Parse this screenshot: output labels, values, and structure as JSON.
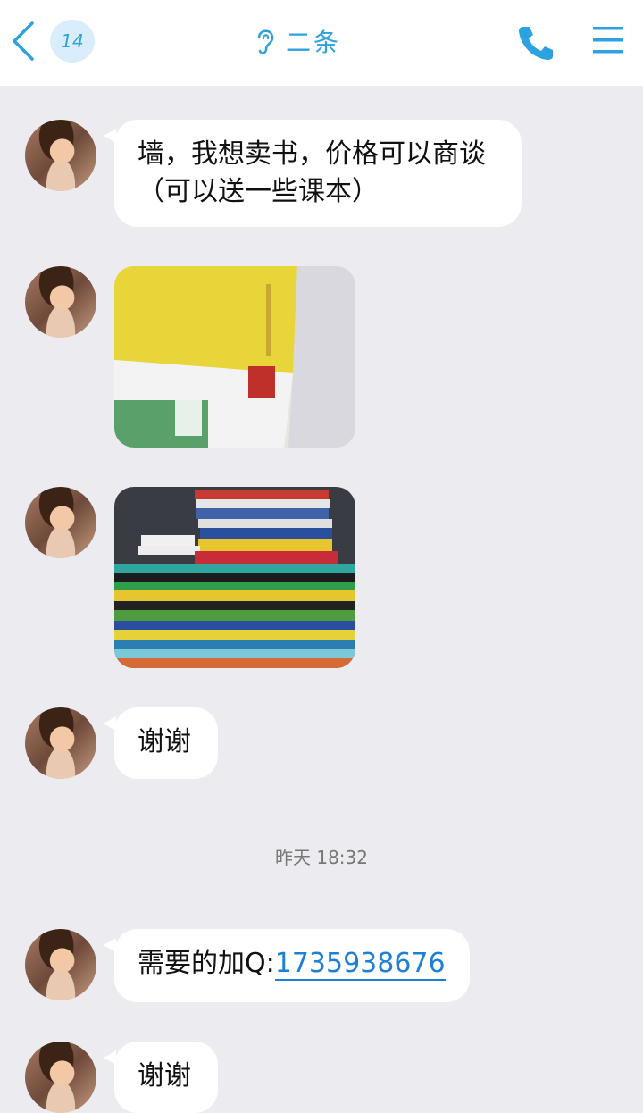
{
  "header": {
    "badge_count": "14",
    "title": "二条"
  },
  "messages": [
    {
      "text": "墙，我想卖书，价格可以商谈（可以送一些课本）"
    },
    {
      "image": "books-photo-1"
    },
    {
      "image": "books-photo-2"
    },
    {
      "text": "谢谢"
    },
    {
      "text_prefix": "需要的加Q:",
      "qq_number": "1735938676"
    },
    {
      "text": "谢谢"
    }
  ],
  "timestamp": "昨天 18:32",
  "colors": {
    "accent": "#2da2e0",
    "background": "#ebebf0",
    "bubble": "#ffffff",
    "link": "#1e7fd6"
  },
  "icons": [
    "back-chevron-icon",
    "ear-icon",
    "phone-icon",
    "menu-icon"
  ]
}
